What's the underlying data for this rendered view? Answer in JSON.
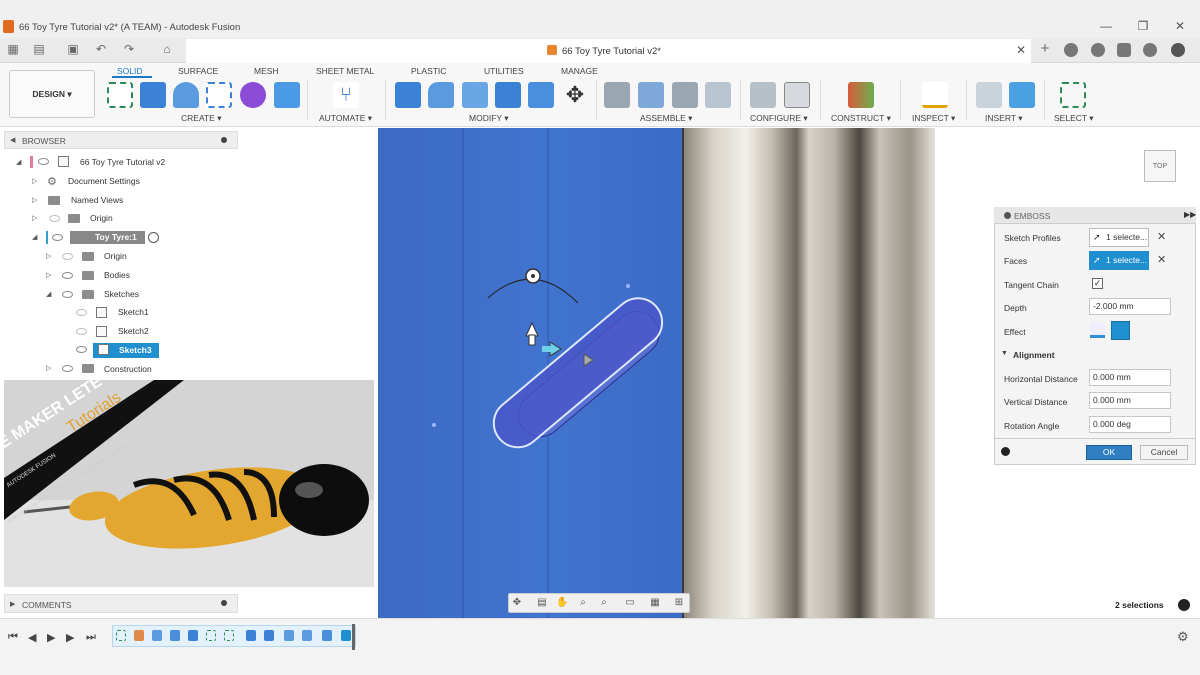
{
  "window": {
    "title": "66 Toy Tyre Tutorial v2* (A TEAM) - Autodesk Fusion",
    "minimize": "—",
    "maximize": "❐",
    "close": "✕"
  },
  "document_tab": {
    "label": "66 Toy Tyre Tutorial v2*",
    "close": "✕"
  },
  "workspace": {
    "label": "DESIGN ▾"
  },
  "tabs": [
    "SOLID",
    "SURFACE",
    "MESH",
    "SHEET METAL",
    "PLASTIC",
    "UTILITIES",
    "MANAGE"
  ],
  "groups": [
    "CREATE ▾",
    "AUTOMATE ▾",
    "MODIFY ▾",
    "ASSEMBLE ▾",
    "CONFIGURE ▾",
    "CONSTRUCT ▾",
    "INSPECT ▾",
    "INSERT ▾",
    "SELECT ▾"
  ],
  "browser": {
    "title": "BROWSER",
    "items": [
      {
        "label": "66 Toy Tyre Tutorial v2"
      },
      {
        "label": "Document Settings"
      },
      {
        "label": "Named Views"
      },
      {
        "label": "Origin"
      },
      {
        "label": "Toy Tyre:1"
      },
      {
        "label": "Origin"
      },
      {
        "label": "Bodies"
      },
      {
        "label": "Sketches"
      },
      {
        "label": "Sketch1"
      },
      {
        "label": "Sketch2"
      },
      {
        "label": "Sketch3"
      },
      {
        "label": "Construction"
      }
    ]
  },
  "thumbnail": {
    "brand_line1": "E MAKER LETE",
    "brand_line2": "Tutorials",
    "brand_line3": "AUTODESK FUSION",
    "brand_line4": "3D MODELING | 3D PRINTING | SHEET METAL DESIGN | MANUFACTURING"
  },
  "comments": {
    "label": "COMMENTS"
  },
  "viewcube": {
    "label": "TOP"
  },
  "emboss": {
    "title": "EMBOSS",
    "sketch_profiles_label": "Sketch Profiles",
    "sketch_profiles_value": "1 selecte...",
    "faces_label": "Faces",
    "faces_value": "1 selecte...",
    "tangent_chain_label": "Tangent Chain",
    "tangent_chain_checked": true,
    "depth_label": "Depth",
    "depth_value": "-2.000 mm",
    "effect_label": "Effect",
    "alignment_label": "Alignment",
    "horizontal_distance_label": "Horizontal Distance",
    "horizontal_distance_value": "0.000 mm",
    "vertical_distance_label": "Vertical Distance",
    "vertical_distance_value": "0.000 mm",
    "rotation_angle_label": "Rotation Angle",
    "rotation_angle_value": "0.000 deg",
    "ok_label": "OK",
    "cancel_label": "Cancel"
  },
  "status": {
    "selections": "2 selections"
  },
  "colors": {
    "accent": "#1f8fd0",
    "viewport_blue": "#3f6fc8",
    "profile_blue": "#4a55c8"
  }
}
